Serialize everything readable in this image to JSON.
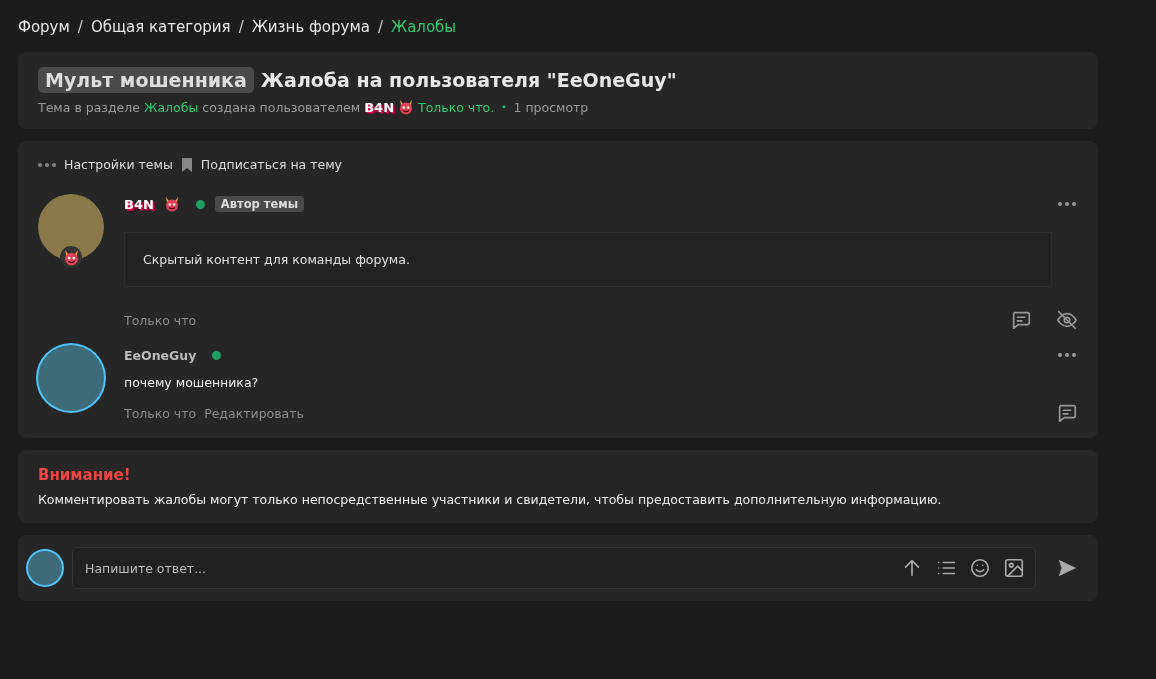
{
  "breadcrumb_separator": "/",
  "breadcrumbs": [
    {
      "label": "Форум",
      "current": false
    },
    {
      "label": "Общая категория",
      "current": false
    },
    {
      "label": "Жизнь форума",
      "current": false
    },
    {
      "label": "Жалобы",
      "current": true
    }
  ],
  "thread": {
    "prefix": "Мульт мошенника",
    "title": "Жалоба на пользователя \"EeOneGuy\"",
    "meta_intro": "Тема в разделе",
    "section": "Жалобы",
    "meta_created": "создана пользователем",
    "author": "B4N",
    "time": "Только что.",
    "meta_separator": "•",
    "views": "1 просмотр"
  },
  "toolbar": [
    "Настройки темы",
    "Подписаться на тему"
  ],
  "posts": [
    {
      "author": "B4N",
      "styled_name": true,
      "online": true,
      "badge": "Автор темы",
      "kind": "hidden",
      "content": "Скрытый контент для команды форума.",
      "time": "Только что",
      "hide_button": true
    },
    {
      "author": "EeOneGuy",
      "styled_name": false,
      "online": true,
      "kind": "text",
      "content": "почему мошенника?",
      "time": "Только что",
      "edit_link": "Редактировать"
    }
  ],
  "notice": {
    "title": "Внимание!",
    "text": "Комментировать жалобы могут только непосредственные участники и свидетели, чтобы предоставить дополнительную информацию."
  },
  "reply": {
    "placeholder": "Напишите ответ..."
  }
}
